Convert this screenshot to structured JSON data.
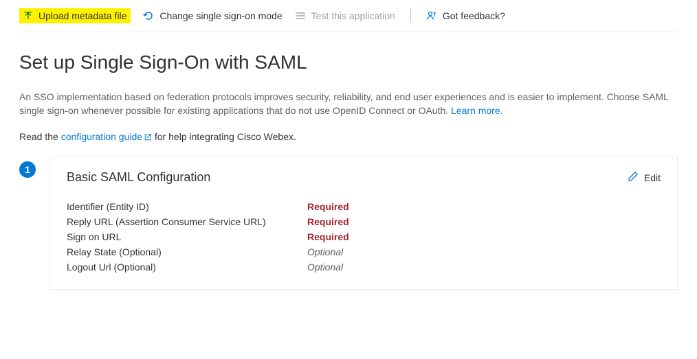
{
  "toolbar": {
    "upload_label": "Upload metadata file",
    "change_mode_label": "Change single sign-on mode",
    "test_label": "Test this application",
    "feedback_label": "Got feedback?"
  },
  "page_title": "Set up Single Sign-On with SAML",
  "intro": {
    "text_before": "An SSO implementation based on federation protocols improves security, reliability, and end user experiences and is easier to implement. Choose SAML single sign-on whenever possible for existing applications that do not use OpenID Connect or OAuth. ",
    "learn_more": "Learn more."
  },
  "guide": {
    "before": "Read the ",
    "link": "configuration guide",
    "after": " for help integrating Cisco Webex."
  },
  "step": {
    "number": "1",
    "card_title": "Basic SAML Configuration",
    "edit_label": "Edit",
    "rows": [
      {
        "label": "Identifier (Entity ID)",
        "value": "Required",
        "type": "required"
      },
      {
        "label": "Reply URL (Assertion Consumer Service URL)",
        "value": "Required",
        "type": "required"
      },
      {
        "label": "Sign on URL",
        "value": "Required",
        "type": "required"
      },
      {
        "label": "Relay State (Optional)",
        "value": "Optional",
        "type": "optional"
      },
      {
        "label": "Logout Url (Optional)",
        "value": "Optional",
        "type": "optional"
      }
    ]
  }
}
